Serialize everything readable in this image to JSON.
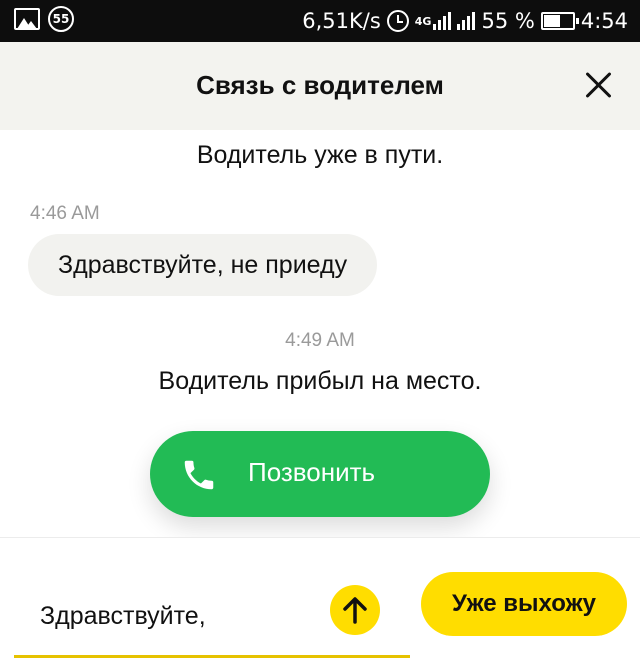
{
  "status_bar": {
    "notification_badge": "55",
    "speed": "6,51K/s",
    "network": "4G",
    "battery": "55 %",
    "time": "4:54"
  },
  "header": {
    "title": "Связь с водителем"
  },
  "chat": {
    "driver_on_way": "Водитель уже в пути.",
    "msg_time": "4:46 AM",
    "user_message": "Здравствуйте, не приеду",
    "arrived_time": "4:49 AM",
    "driver_arrived": "Водитель прибыл на место.",
    "call_label": "Позвонить"
  },
  "composer": {
    "input_value": "Здравствуйте,",
    "quick_reply": "Уже выхожу"
  },
  "colors": {
    "accent_yellow": "#ffdd00",
    "call_green": "#22bb55",
    "header_bg": "#f3f3ef"
  }
}
